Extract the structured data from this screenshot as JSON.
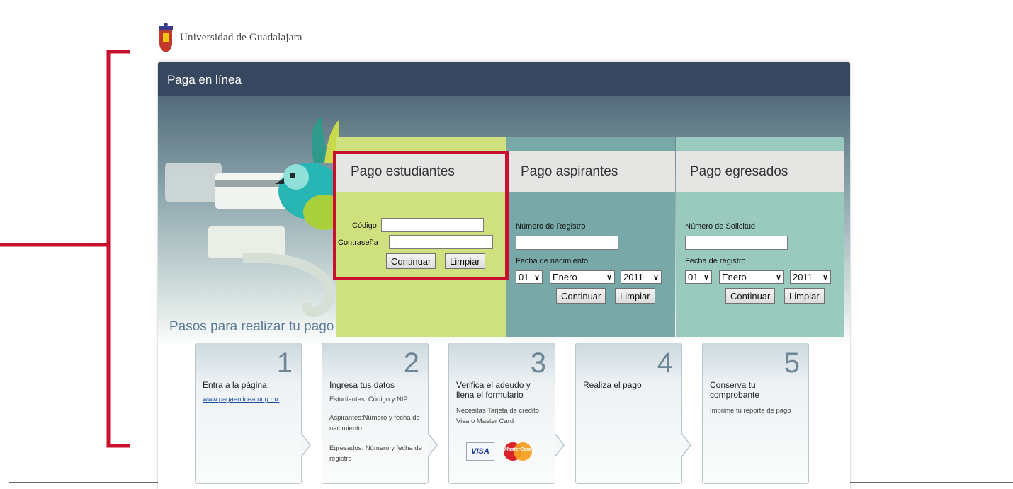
{
  "logo": {
    "name": "Universidad de Guadalajara"
  },
  "header": {
    "title": "Paga en línea"
  },
  "estudiantes": {
    "title": "Pago estudiantes",
    "codigo_label": "Código",
    "codigo_value": "",
    "password_label": "Contraseña",
    "password_value": "",
    "continue_label": "Continuar",
    "clear_label": "Limpiar"
  },
  "aspirantes": {
    "title": "Pago aspirantes",
    "registro_label": "Número de Registro",
    "registro_value": "",
    "date_label": "Fecha de nacimiento",
    "day": "01",
    "month": "Enero",
    "year": "2011",
    "continue_label": "Continuar",
    "clear_label": "Limpiar"
  },
  "egresados": {
    "title": "Pago egresados",
    "solicitud_label": "Número de Solicitud",
    "solicitud_value": "",
    "date_label": "Fecha de registro",
    "day": "01",
    "month": "Enero",
    "year": "2011",
    "continue_label": "Continuar",
    "clear_label": "Limpiar"
  },
  "steps": {
    "title": "Pasos para realizar tu pago",
    "items": [
      {
        "number": "1",
        "title": "Entra a la página:",
        "link": "www.pagaenlinea.udg.mx"
      },
      {
        "number": "2",
        "title": "Ingresa tus datos",
        "line1": "Estudiantes: Código y NIP",
        "line2": "Aspirantes:Número y fecha de nacimiento",
        "line3": "Egresados: Número y fecha de registro"
      },
      {
        "number": "3",
        "title": "Verifica el adeudo y llena el formulario",
        "line1": "Necesitas Tarjeta de credito Visa o Master Card",
        "visa": "VISA",
        "mastercard": "MasterCard"
      },
      {
        "number": "4",
        "title": "Realiza el pago"
      },
      {
        "number": "5",
        "title": "Conserva tu comprobante",
        "line1": "Imprime tu reporte de pago"
      }
    ]
  },
  "colors": {
    "highlight": "#c8102e",
    "header": "#37475f",
    "estudiantes": "#cfe07f",
    "aspirantes": "#78a9a8",
    "egresados": "#9ac9bd"
  }
}
